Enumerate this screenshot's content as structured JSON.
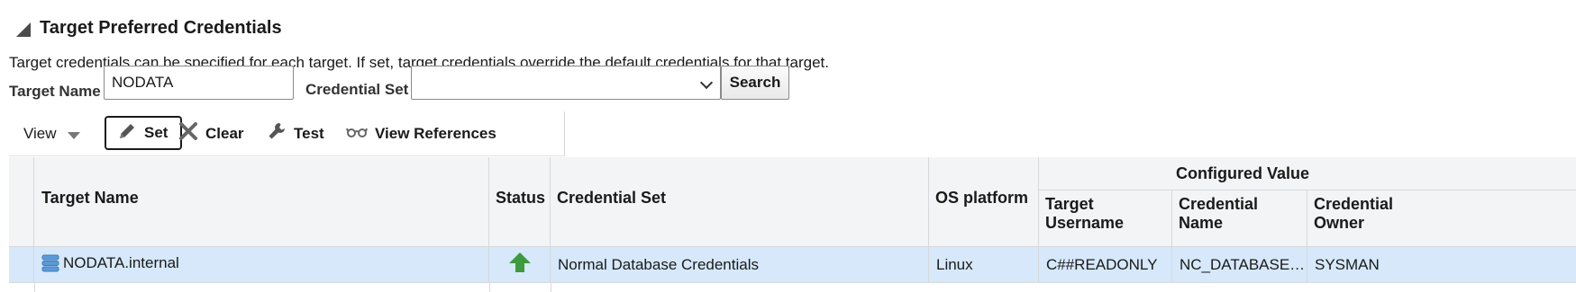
{
  "section": {
    "title": "Target Preferred Credentials",
    "description": "Target credentials can be specified for each target. If set, target credentials override the default credentials for that target."
  },
  "search": {
    "target_name_label": "Target Name",
    "target_name_value": "NODATA",
    "credential_set_label": "Credential Set",
    "credential_set_value": "",
    "search_button": "Search"
  },
  "toolbar": {
    "view_label": "View",
    "set_label": "Set",
    "clear_label": "Clear",
    "test_label": "Test",
    "view_references_label": "View References"
  },
  "table": {
    "headers": {
      "target_name": "Target Name",
      "status": "Status",
      "credential_set": "Credential Set",
      "os_platform": "OS platform",
      "configured_value": "Configured Value",
      "target_username": "Target Username",
      "credential_name": "Credential Name",
      "credential_owner": "Credential Owner"
    },
    "rows": [
      {
        "target_name": "NODATA.internal",
        "target_icon": "database-icon",
        "status": "up",
        "status_icon": "status-up-arrow-icon",
        "credential_set": "Normal Database Credentials",
        "os_platform": "Linux",
        "target_username": "C##READONLY",
        "credential_name": "NC_DATABASE…",
        "credential_owner": "SYSMAN"
      }
    ]
  },
  "colors": {
    "selected_row": "#d6e8fa",
    "header_bg": "#f2f4f6",
    "status_up": "#3d9a3d",
    "database_icon": "#3b7bbf"
  }
}
